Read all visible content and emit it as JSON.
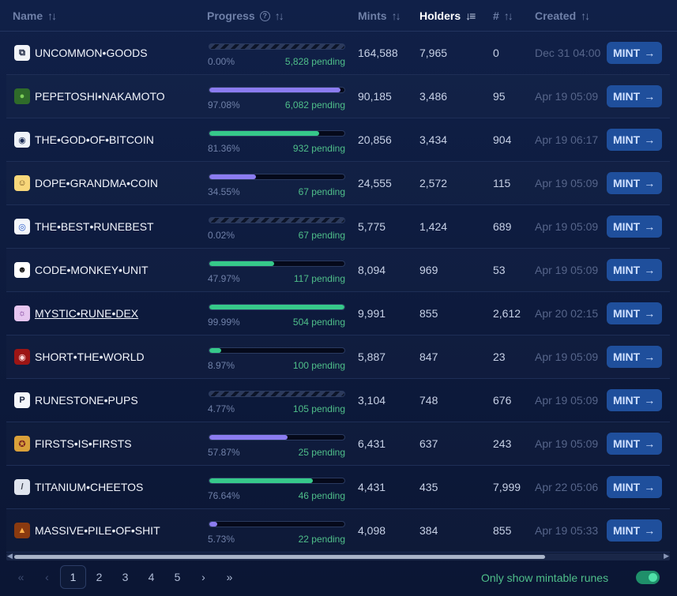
{
  "header": {
    "name": "Name",
    "progress": "Progress",
    "mints": "Mints",
    "holders": "Holders",
    "number": "#",
    "created": "Created"
  },
  "colors": {
    "purple": "#8b7cf0",
    "green": "#36c98a",
    "mint_button": "#1f4f9c"
  },
  "mint_label": "MINT",
  "rows": [
    {
      "name": "UNCOMMON•GOODS",
      "progress_pct": "0.00%",
      "progress": 0.0,
      "pending": "5,828 pending",
      "mints": "164,588",
      "holders": "7,965",
      "number": "0",
      "created": "Dec 31 04:00",
      "bar": "striped",
      "icon": "goods-icon",
      "glyph": "⧉"
    },
    {
      "name": "PEPETOSHI•NAKAMOTO",
      "progress_pct": "97.08%",
      "progress": 97.08,
      "pending": "6,082 pending",
      "mints": "90,185",
      "holders": "3,486",
      "number": "95",
      "created": "Apr 19 05:09",
      "bar": "purple",
      "icon": "pepe-icon",
      "glyph": "●"
    },
    {
      "name": "THE•GOD•OF•BITCOIN",
      "progress_pct": "81.36%",
      "progress": 81.36,
      "pending": "932 pending",
      "mints": "20,856",
      "holders": "3,434",
      "number": "904",
      "created": "Apr 19 06:17",
      "bar": "green",
      "icon": "eye-icon",
      "glyph": "◉"
    },
    {
      "name": "DOPE•GRANDMA•COIN",
      "progress_pct": "34.55%",
      "progress": 34.55,
      "pending": "67 pending",
      "mints": "24,555",
      "holders": "2,572",
      "number": "115",
      "created": "Apr 19 05:09",
      "bar": "purple",
      "icon": "grandma-icon",
      "glyph": "☺"
    },
    {
      "name": "THE•BEST•RUNEBEST",
      "progress_pct": "0.02%",
      "progress": 0.02,
      "pending": "67 pending",
      "mints": "5,775",
      "holders": "1,424",
      "number": "689",
      "created": "Apr 19 05:09",
      "bar": "striped",
      "icon": "target-icon",
      "glyph": "◎"
    },
    {
      "name": "CODE•MONKEY•UNIT",
      "progress_pct": "47.97%",
      "progress": 47.97,
      "pending": "117 pending",
      "mints": "8,094",
      "holders": "969",
      "number": "53",
      "created": "Apr 19 05:09",
      "bar": "green",
      "icon": "monkey-icon",
      "glyph": "☻"
    },
    {
      "name": "MYSTIC•RUNE•DEX",
      "progress_pct": "99.99%",
      "progress": 99.99,
      "pending": "504 pending",
      "mints": "9,991",
      "holders": "855",
      "number": "2,612",
      "created": "Apr 20 02:15",
      "bar": "green",
      "icon": "mystic-icon",
      "glyph": "☼",
      "link": true
    },
    {
      "name": "SHORT•THE•WORLD",
      "progress_pct": "8.97%",
      "progress": 8.97,
      "pending": "100 pending",
      "mints": "5,887",
      "holders": "847",
      "number": "23",
      "created": "Apr 19 05:09",
      "bar": "green",
      "icon": "red-eye-icon",
      "glyph": "◉"
    },
    {
      "name": "RUNESTONE•PUPS",
      "progress_pct": "4.77%",
      "progress": 4.77,
      "pending": "105 pending",
      "mints": "3,104",
      "holders": "748",
      "number": "676",
      "created": "Apr 19 05:09",
      "bar": "striped",
      "icon": "p-letter-icon",
      "glyph": "P"
    },
    {
      "name": "FIRSTS•IS•FIRSTS",
      "progress_pct": "57.87%",
      "progress": 57.87,
      "pending": "25 pending",
      "mints": "6,431",
      "holders": "637",
      "number": "243",
      "created": "Apr 19 05:09",
      "bar": "purple",
      "icon": "medal-icon",
      "glyph": "✪"
    },
    {
      "name": "TITANIUM•CHEETOS",
      "progress_pct": "76.64%",
      "progress": 76.64,
      "pending": "46 pending",
      "mints": "4,431",
      "holders": "435",
      "number": "7,999",
      "created": "Apr 22 05:06",
      "bar": "green",
      "icon": "cheeto-icon",
      "glyph": "/"
    },
    {
      "name": "MASSIVE•PILE•OF•SHIT",
      "progress_pct": "5.73%",
      "progress": 5.73,
      "pending": "22 pending",
      "mints": "4,098",
      "holders": "384",
      "number": "855",
      "created": "Apr 19 05:33",
      "bar": "purple",
      "icon": "pile-icon",
      "glyph": "▲"
    }
  ],
  "pagination": {
    "first": "«",
    "prev": "‹",
    "pages": [
      "1",
      "2",
      "3",
      "4",
      "5"
    ],
    "current": "1",
    "next": "›",
    "last": "»"
  },
  "toggle": {
    "label": "Only show mintable runes",
    "on": true
  }
}
